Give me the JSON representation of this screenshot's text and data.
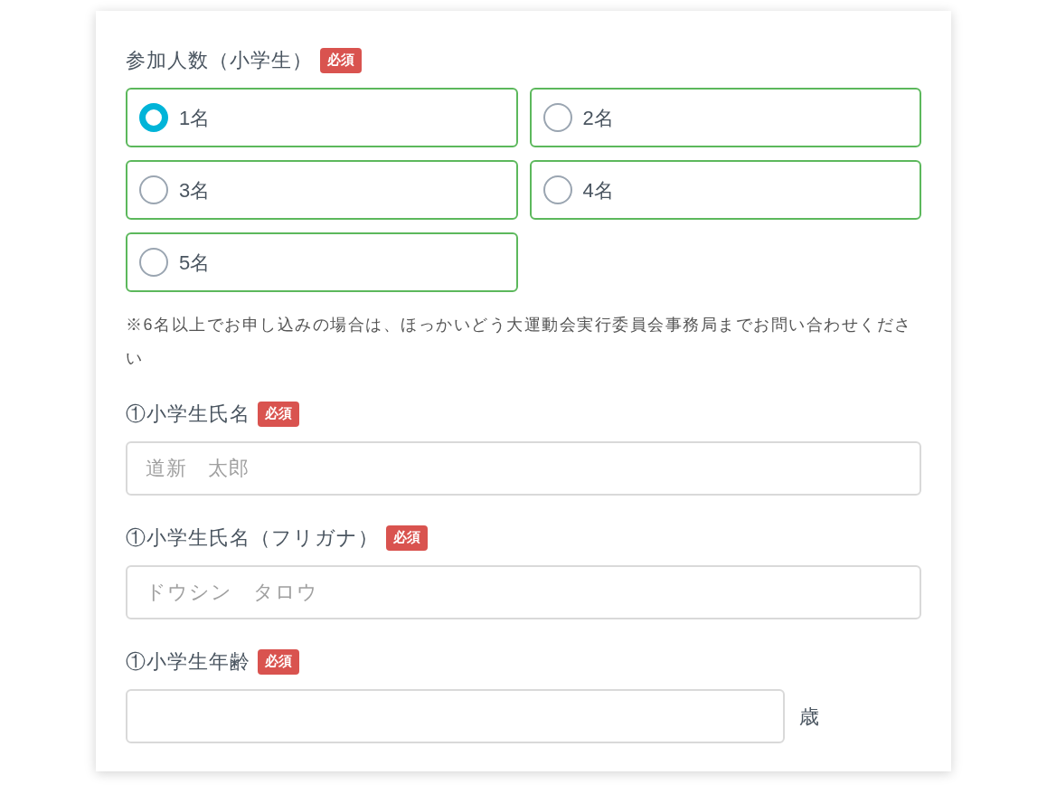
{
  "participants": {
    "label": "参加人数（小学生）",
    "required_badge": "必須",
    "options": [
      {
        "label": "1名",
        "selected": true
      },
      {
        "label": "2名",
        "selected": false
      },
      {
        "label": "3名",
        "selected": false
      },
      {
        "label": "4名",
        "selected": false
      },
      {
        "label": "5名",
        "selected": false
      }
    ],
    "note": "※6名以上でお申し込みの場合は、ほっかいどう大運動会実行委員会事務局までお問い合わせください"
  },
  "fields": [
    {
      "label": "①小学生氏名",
      "required_badge": "必須",
      "placeholder": "道新　太郎"
    },
    {
      "label": "①小学生氏名（フリガナ）",
      "required_badge": "必須",
      "placeholder": "ドウシン　タロウ"
    },
    {
      "label": "①小学生年齢",
      "required_badge": "必須",
      "suffix": "歳"
    }
  ]
}
